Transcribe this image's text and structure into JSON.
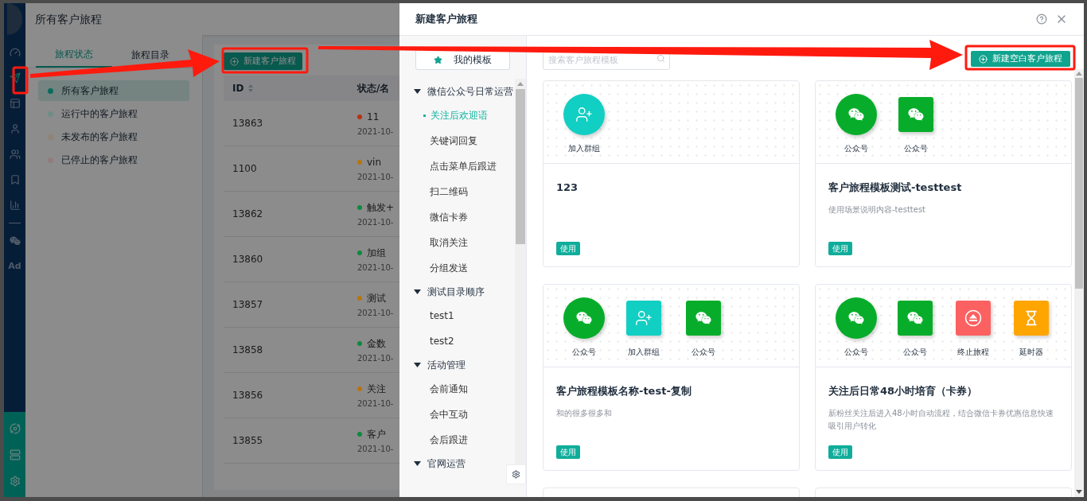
{
  "background_page": {
    "title": "所有客户旅程",
    "nav": [
      {
        "kind": "dashboard",
        "selected": false
      },
      {
        "kind": "send",
        "selected": true
      },
      {
        "kind": "layout",
        "selected": false
      },
      {
        "kind": "user",
        "selected": false
      },
      {
        "kind": "users",
        "selected": false
      },
      {
        "kind": "bookmark",
        "selected": false
      },
      {
        "kind": "chart",
        "selected": false
      },
      {
        "kind": "wechat",
        "selected": false
      },
      {
        "kind": "text",
        "label": "Ad",
        "selected": false
      }
    ],
    "nav_bottom": [
      {
        "kind": "hub"
      },
      {
        "kind": "server"
      },
      {
        "kind": "settings"
      }
    ],
    "tabs": [
      {
        "label": "旅程状态",
        "selected": true
      },
      {
        "label": "旅程目录",
        "selected": false
      }
    ],
    "filters": [
      {
        "label": "所有客户旅程",
        "selected": true,
        "color": "#0a6b5e"
      },
      {
        "label": "运行中的客户旅程",
        "selected": false,
        "color": "#6f8d86"
      },
      {
        "label": "未发布的客户旅程",
        "selected": false,
        "color": "#8f8376"
      },
      {
        "label": "已停止的客户旅程",
        "selected": false,
        "color": "#917c7c"
      }
    ],
    "new_button": {
      "label": "新建客户旅程"
    },
    "table": {
      "columns": [
        "ID",
        "状态/名"
      ],
      "rows": [
        {
          "id": "13863",
          "name": "11",
          "date": "2021-10-",
          "color": "#b8330f"
        },
        {
          "id": "1100",
          "name": "vin",
          "date": "2021-10-",
          "color": "#b87410"
        },
        {
          "id": "13862",
          "name": "触发+",
          "date": "2021-10-",
          "color": "#0d8a3e"
        },
        {
          "id": "13860",
          "name": "加组",
          "date": "2021-10-",
          "color": "#0d8a3e"
        },
        {
          "id": "13857",
          "name": "测试",
          "date": "2021-10-",
          "color": "#b87410"
        },
        {
          "id": "13858",
          "name": "金数",
          "date": "2021-10-",
          "color": "#0d8a3e"
        },
        {
          "id": "13856",
          "name": "关注",
          "date": "2021-10-",
          "color": "#b87410"
        },
        {
          "id": "13855",
          "name": "客户",
          "date": "2021-10-",
          "color": "#0d8a3e"
        }
      ]
    }
  },
  "modal": {
    "title": "新建客户旅程",
    "my_templates": {
      "label": "我的模板"
    },
    "tree": [
      {
        "label": "微信公众号日常运营",
        "expanded": true,
        "children": [
          {
            "label": "关注后欢迎语",
            "selected": true
          },
          {
            "label": "关键词回复",
            "selected": false
          },
          {
            "label": "点击菜单后跟进",
            "selected": false
          },
          {
            "label": "扫二维码",
            "selected": false
          },
          {
            "label": "微信卡券",
            "selected": false
          },
          {
            "label": "取消关注",
            "selected": false
          },
          {
            "label": "分组发送",
            "selected": false
          }
        ]
      },
      {
        "label": "测试目录顺序",
        "expanded": true,
        "children": [
          {
            "label": "test1",
            "selected": false
          },
          {
            "label": "test2",
            "selected": false
          }
        ]
      },
      {
        "label": "活动管理",
        "expanded": true,
        "children": [
          {
            "label": "会前通知",
            "selected": false
          },
          {
            "label": "会中互动",
            "selected": false
          },
          {
            "label": "会后跟进",
            "selected": false
          }
        ]
      },
      {
        "label": "官网运营",
        "expanded": true
      }
    ],
    "search": {
      "placeholder": "搜索客户旅程模板"
    },
    "new_blank_button": {
      "label": "新建空白客户旅程"
    },
    "cards": [
      {
        "nodes": [
          {
            "kind": "group",
            "round": true,
            "label": "加入群组"
          }
        ],
        "title": "123",
        "use_button": "使用"
      },
      {
        "nodes": [
          {
            "kind": "wechat",
            "round": true,
            "label": "公众号"
          },
          {
            "kind": "wechat",
            "round": false,
            "label": "公众号"
          }
        ],
        "title": "客户旅程模板测试-testtest",
        "description": "使用场景说明内容-testtest",
        "use_button": "使用"
      },
      {
        "nodes": [
          {
            "kind": "wechat",
            "round": true,
            "label": "公众号"
          },
          {
            "kind": "group",
            "round": false,
            "label": "加入群组"
          },
          {
            "kind": "wechat",
            "round": false,
            "label": "公众号"
          }
        ],
        "title": "客户旅程模板名称-test-复制",
        "description": "和的很多很多和",
        "use_button": "使用"
      },
      {
        "nodes": [
          {
            "kind": "wechat",
            "round": true,
            "label": "公众号"
          },
          {
            "kind": "wechat",
            "round": false,
            "label": "公众号"
          },
          {
            "kind": "stop",
            "round": false,
            "label": "终止旅程"
          },
          {
            "kind": "timer",
            "round": false,
            "label": "延时器"
          }
        ],
        "title": "关注后日常48小时培育（卡券）",
        "description": "新粉丝关注后进入48小时自动流程，结合微信卡券优惠信息快速吸引用户转化",
        "use_button": "使用"
      }
    ]
  }
}
